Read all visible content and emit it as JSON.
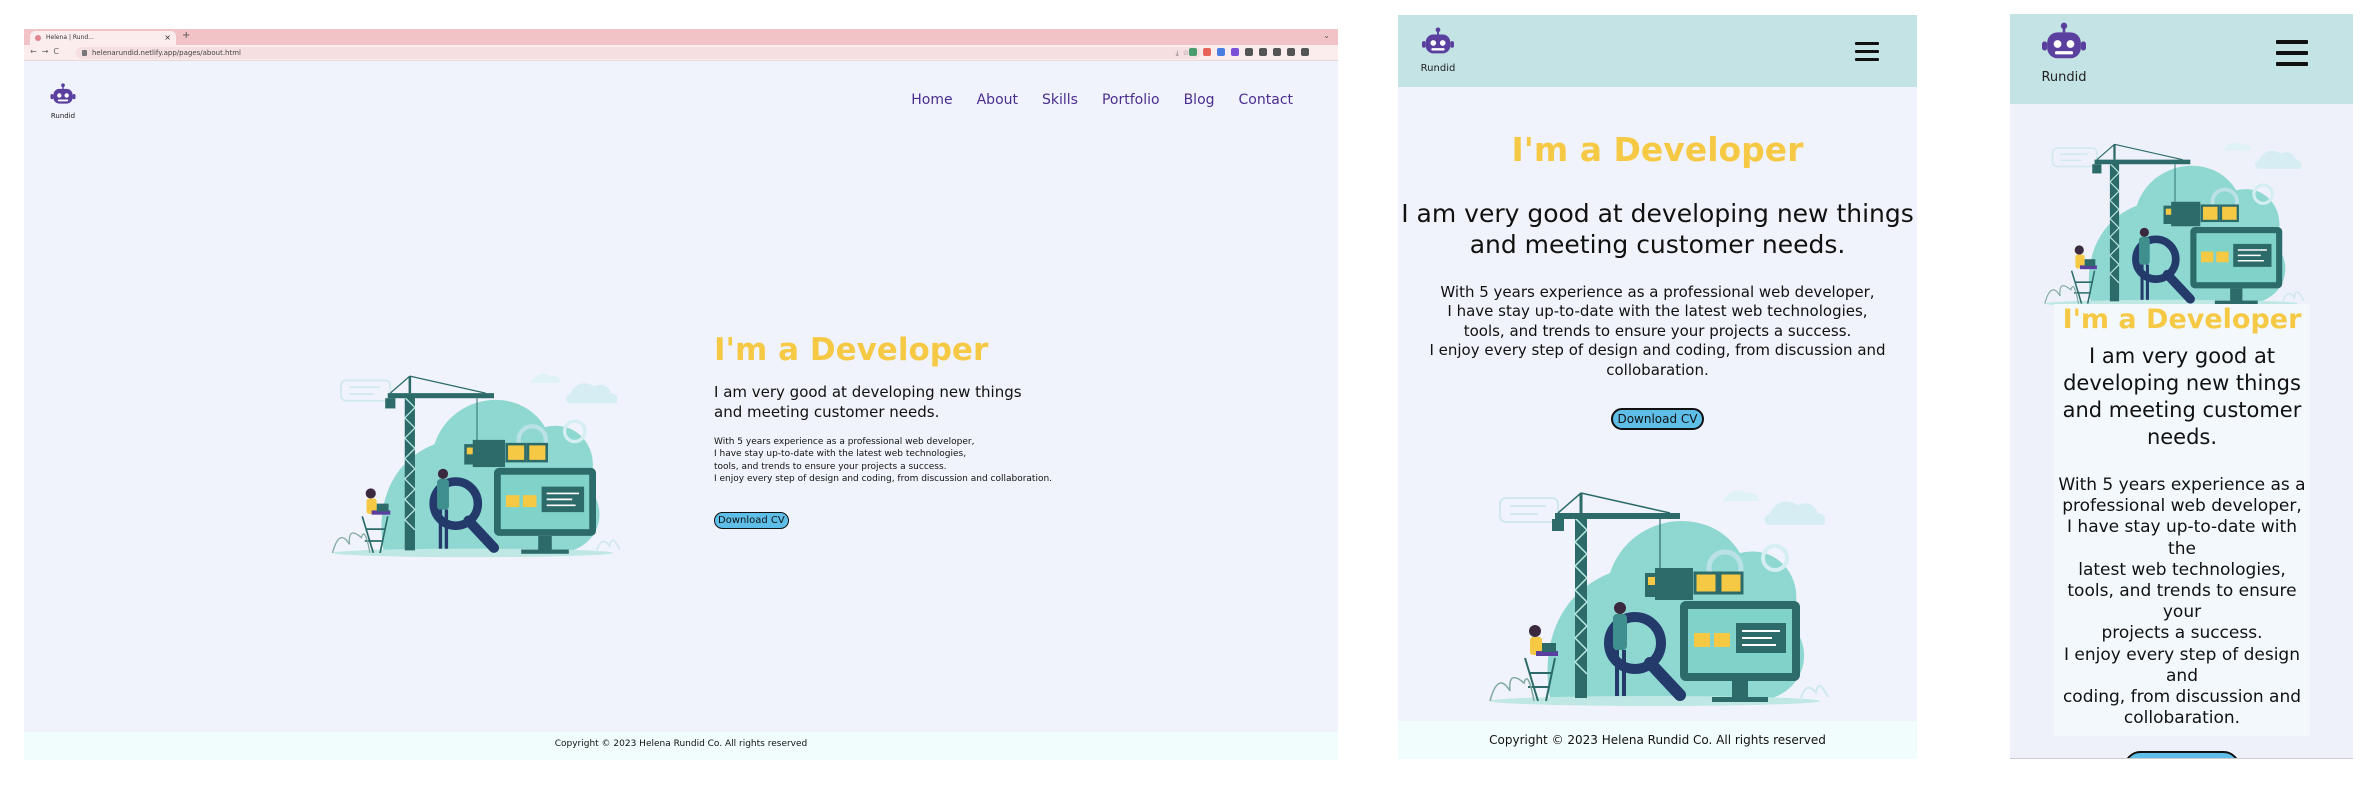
{
  "browser": {
    "tab_title": "Helena | Rund...",
    "tab_close": "×",
    "new_tab": "+",
    "nav_arrows": "←→C",
    "address": "helenarundid.netlify.app/pages/about.html",
    "address_icons": "⤓☆",
    "caret": "⌄",
    "extension_colors": [
      "#4a9b6e",
      "#e8645a",
      "#4a7de0",
      "#7b4fd8",
      "#555555",
      "#555555",
      "#555555",
      "#555555",
      "#555555"
    ]
  },
  "logo": {
    "text": "Rundid",
    "robot_color": "#5a3f9e"
  },
  "nav": {
    "items": [
      "Home",
      "About",
      "Skills",
      "Portfolio",
      "Blog",
      "Contact"
    ]
  },
  "hero": {
    "title": "I'm a Developer",
    "subtitle": "I am very good at developing new things\nand meeting customer needs.",
    "body": "With 5 years experience as a professional web developer,\nI have stay up-to-date with the latest web technologies,\ntools, and trends to ensure your projects a success.\nI enjoy every step of design and coding, from discussion and collaboration.",
    "tablet_body": "With 5 years experience as a professional web developer,\nI have stay up-to-date with the latest web technologies,\ntools, and trends to ensure your projects a success.\nI enjoy every step of design and coding, from discussion and\ncollobaration.",
    "phone_subtitle": "I am very good at\ndeveloping new things\nand meeting customer\nneeds.",
    "phone_body": "With 5 years experience as a\nprofessional web developer,\nI have stay up-to-date with the\nlatest web technologies,\ntools, and trends to ensure your\nprojects a success.\nI enjoy every step of design and\ncoding, from discussion and\ncollobaration.",
    "cta": "Download CV"
  },
  "footer": {
    "text": "Copyright © 2023 Helena Rundid Co. All rights reserved"
  },
  "colors": {
    "accent_yellow": "#f6c945",
    "nav_purple": "#4b2d8f",
    "button_blue": "#5ebee8",
    "header_teal": "#c4e3e4",
    "page_bg": "#f0f3fb"
  },
  "icons": {
    "menu": "hamburger-icon",
    "illustration": "developer-crane-illustration"
  }
}
